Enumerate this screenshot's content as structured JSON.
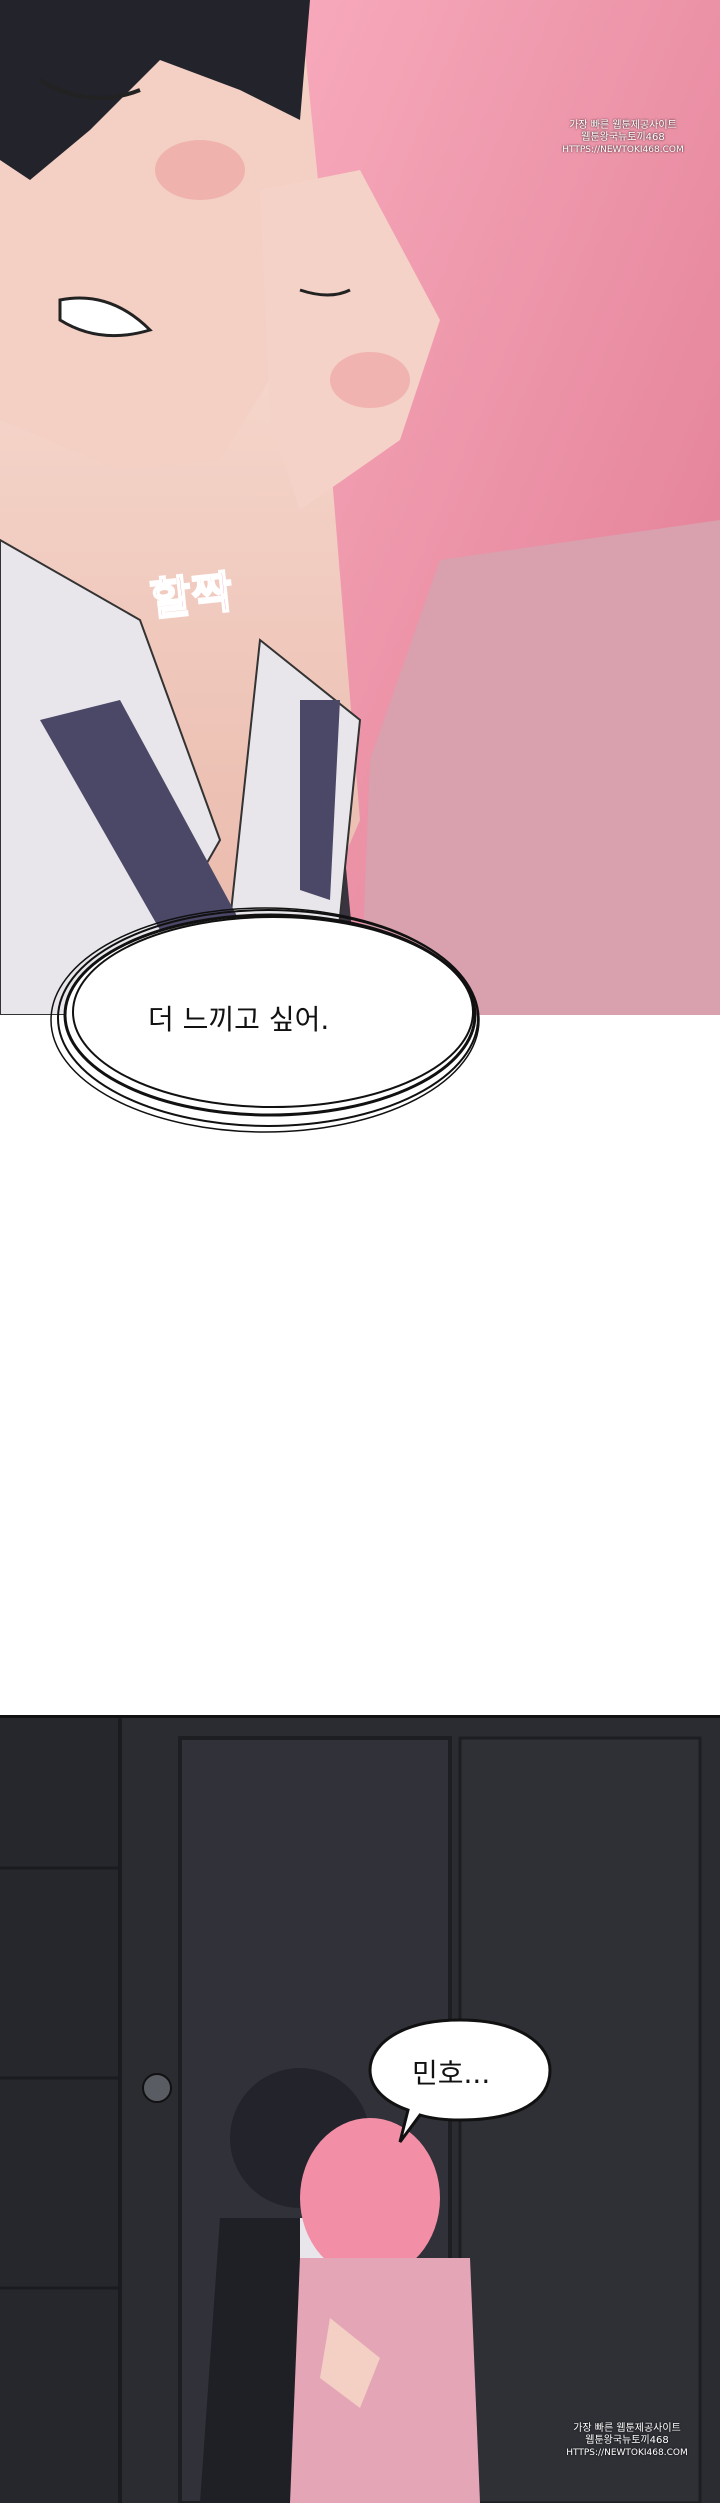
{
  "panels": [
    {
      "id": "top",
      "sfx": "할짝",
      "bubble": "더 느끼고 싶어."
    },
    {
      "id": "bottom",
      "bubble": "민호..."
    }
  ],
  "watermark": {
    "line1": "가장 빠른 웹툰제공사이트",
    "line2": "웹툰왕국뉴토끼468",
    "line3": "HTTPS://NEWTOKI468.COM"
  },
  "colors": {
    "hair_pink": "#f28fa6",
    "hair_dark": "#22232b",
    "skin": "#f2cfc4",
    "shirt": "#e8e6ea",
    "tie": "#4a4767",
    "sfx": "#e3708e"
  }
}
